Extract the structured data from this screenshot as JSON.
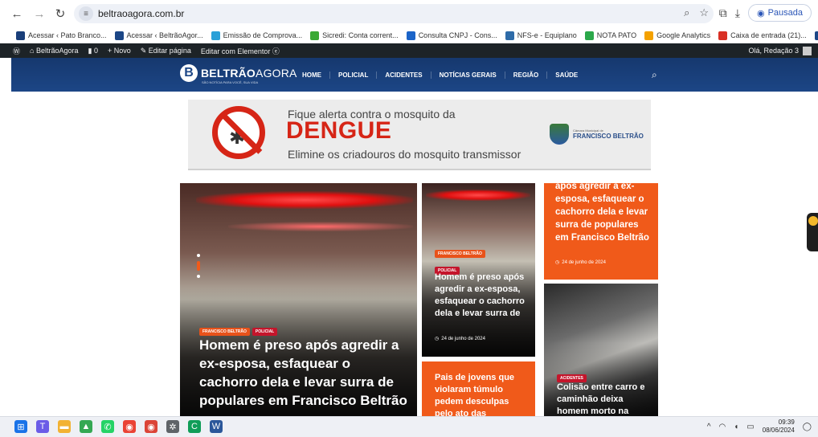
{
  "browser": {
    "url": "beltraoagora.com.br",
    "profile_label": "Pausada",
    "bookmarks": [
      {
        "label": "Acessar ‹ Pato Branco...",
        "icon": "pato-branco-icon",
        "color": "#1a3f7a"
      },
      {
        "label": "Acessar ‹ BeltrãoAgor...",
        "icon": "beltrao-icon",
        "color": "#1c4686"
      },
      {
        "label": "Emissão de Comprova...",
        "icon": "receipt-icon",
        "color": "#2aa0d8"
      },
      {
        "label": "Sicredi: Conta corrent...",
        "icon": "sicredi-icon",
        "color": "#3aa935"
      },
      {
        "label": "Consulta CNPJ - Cons...",
        "icon": "cnpj-icon",
        "color": "#1b64c8"
      },
      {
        "label": "NFS-e - Equiplano",
        "icon": "equiplano-icon",
        "color": "#2e6ba8"
      },
      {
        "label": "NOTA PATO",
        "icon": "nota-pato-icon",
        "color": "#2ba84a"
      },
      {
        "label": "Google Analytics",
        "icon": "analytics-icon",
        "color": "#f4a100"
      },
      {
        "label": "Caixa de entrada (21)...",
        "icon": "gmail-icon",
        "color": "#d93025"
      },
      {
        "label": "Adicionar novo post ‹...",
        "icon": "wordpress-icon",
        "color": "#1c4686"
      }
    ]
  },
  "wp_admin_bar": {
    "site_name": "BeltrãoAgora",
    "comments_count": "0",
    "new_label": "Novo",
    "edit_page_label": "Editar página",
    "elementor_label": "Editar com Elementor",
    "greeting": "Olá, Redação 3"
  },
  "site": {
    "logo_name_bold": "BELTRÃO",
    "logo_name_light": "AGORA",
    "logo_tagline": "SÃO NOTÍCIA PARA VOCÊ, SUA VIDA",
    "menu": [
      "HOME",
      "POLICIAL",
      "ACIDENTES",
      "NOTÍCIAS GERAIS",
      "REGIÃO",
      "SAÚDE"
    ]
  },
  "banner": {
    "line1": "Fique alerta contra o mosquito da",
    "headline": "DENGUE",
    "line3": "Elimine os criadouros do mosquito transmissor",
    "org_small": "Câmara Municipal de",
    "org_big": "FRANCISCO BELTRÃO"
  },
  "cards": {
    "main": {
      "badges": [
        "FRANCISCO BELTRÃO",
        "POLICIAL"
      ],
      "title": "Homem é preso após agredir a ex-esposa, esfaquear o cachorro dela e levar surra de populares em Francisco Beltrão"
    },
    "middle": {
      "badges": [
        "FRANCISCO BELTRÃO",
        "POLICIAL"
      ],
      "title": "Homem é preso após agredir a ex-esposa, esfaquear o cachorro dela e levar surra de",
      "date": "24 de junho de 2024"
    },
    "orange_top": {
      "title": "após agredir a ex-esposa, esfaquear o cachorro dela e levar surra de populares em Francisco Beltrão",
      "date": "24 de junho de 2024"
    },
    "orange_bottom": {
      "title": "Pais de jovens que violaram túmulo pedem desculpas pelo ato das"
    },
    "accident": {
      "badges": [
        "ACIDENTES"
      ],
      "title": "Colisão entre carro e caminhão deixa homem morto na"
    }
  },
  "taskbar": {
    "time": "09:39",
    "date": "08/06/2024"
  }
}
